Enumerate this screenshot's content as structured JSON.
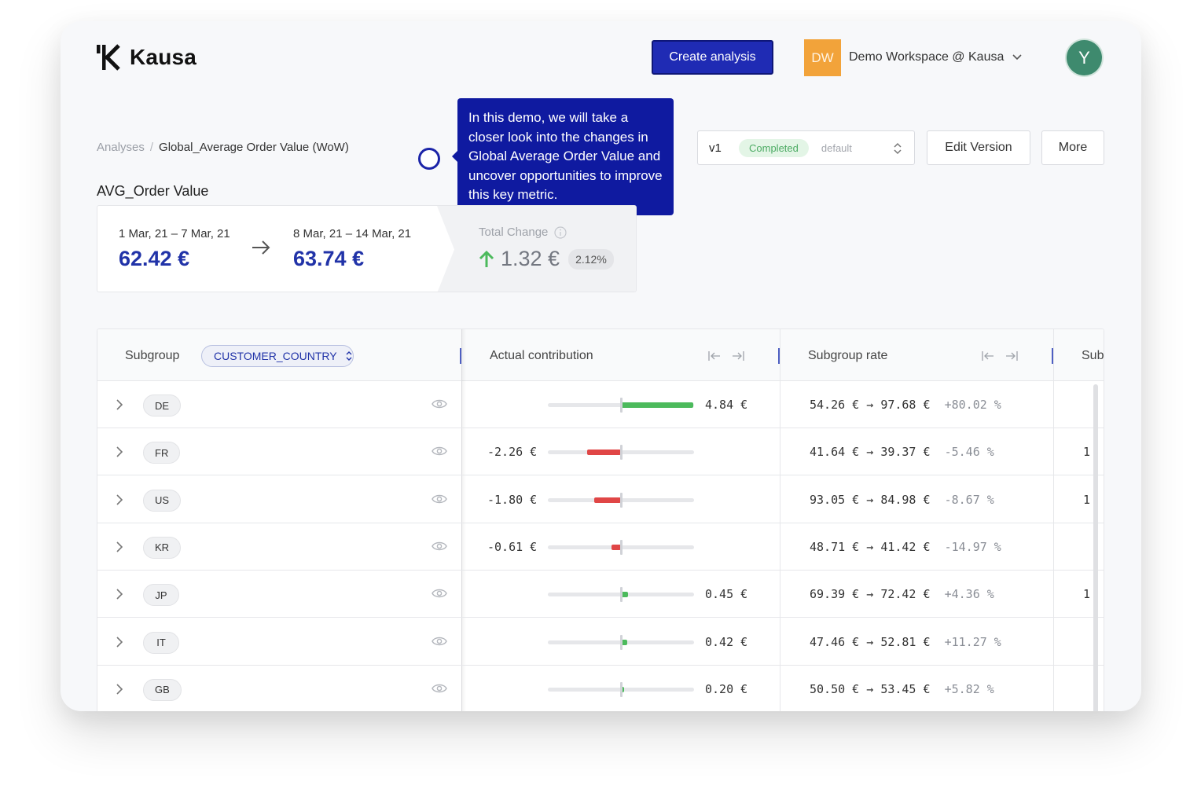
{
  "header": {
    "brand": "Kausa",
    "create_button": "Create analysis",
    "workspace_badge": "DW",
    "workspace_name": "Demo Workspace @ Kausa",
    "avatar_initial": "Y"
  },
  "breadcrumb": {
    "root": "Analyses",
    "separator": "/",
    "current": "Global_Average Order Value (WoW)"
  },
  "page_title": "AVG_Order Value",
  "tour": {
    "text": "In this demo, we will take a closer look into the changes in Global Average Order Value and uncover opportunities to improve this key metric."
  },
  "version": {
    "label": "v1",
    "status": "Completed",
    "tag": "default",
    "edit_button": "Edit Version",
    "more_button": "More"
  },
  "kpi": {
    "period_a": "1 Mar, 21 – 7 Mar, 21",
    "value_a": "62.42 €",
    "period_b": "8 Mar, 21 – 14 Mar, 21",
    "value_b": "63.74 €",
    "total_label": "Total Change",
    "total_value": "1.32 €",
    "total_pct": "2.12%"
  },
  "table": {
    "subgroup_header": "Subgroup",
    "subgroup_selector": "CUSTOMER_COUNTRY",
    "contribution_header": "Actual contribution",
    "rate_header": "Subgroup rate",
    "sub_header_truncated": "Sub",
    "contribution_scale_max": 4.84,
    "rows": [
      {
        "country": "DE",
        "contribution": 4.84,
        "contribution_label": "4.84 €",
        "rate_from": "54.26 €",
        "rate_to": "97.68 €",
        "rate_change": "+80.02 %",
        "sub": ""
      },
      {
        "country": "FR",
        "contribution": -2.26,
        "contribution_label": "-2.26 €",
        "rate_from": "41.64 €",
        "rate_to": "39.37 €",
        "rate_change": "-5.46 %",
        "sub": "1"
      },
      {
        "country": "US",
        "contribution": -1.8,
        "contribution_label": "-1.80 €",
        "rate_from": "93.05 €",
        "rate_to": "84.98 €",
        "rate_change": "-8.67 %",
        "sub": "1"
      },
      {
        "country": "KR",
        "contribution": -0.61,
        "contribution_label": "-0.61 €",
        "rate_from": "48.71 €",
        "rate_to": "41.42 €",
        "rate_change": "-14.97 %",
        "sub": ""
      },
      {
        "country": "JP",
        "contribution": 0.45,
        "contribution_label": "0.45 €",
        "rate_from": "69.39 €",
        "rate_to": "72.42 €",
        "rate_change": "+4.36 %",
        "sub": "1"
      },
      {
        "country": "IT",
        "contribution": 0.42,
        "contribution_label": "0.42 €",
        "rate_from": "47.46 €",
        "rate_to": "52.81 €",
        "rate_change": "+11.27 %",
        "sub": ""
      },
      {
        "country": "GB",
        "contribution": 0.2,
        "contribution_label": "0.20 €",
        "rate_from": "50.50 €",
        "rate_to": "53.45 €",
        "rate_change": "+5.82 %",
        "sub": ""
      }
    ]
  },
  "colors": {
    "primary": "#1f2bb4",
    "positive": "#4cba5c",
    "negative": "#e04646",
    "workspace": "#f2a33a",
    "avatar": "#3e8a6e"
  }
}
